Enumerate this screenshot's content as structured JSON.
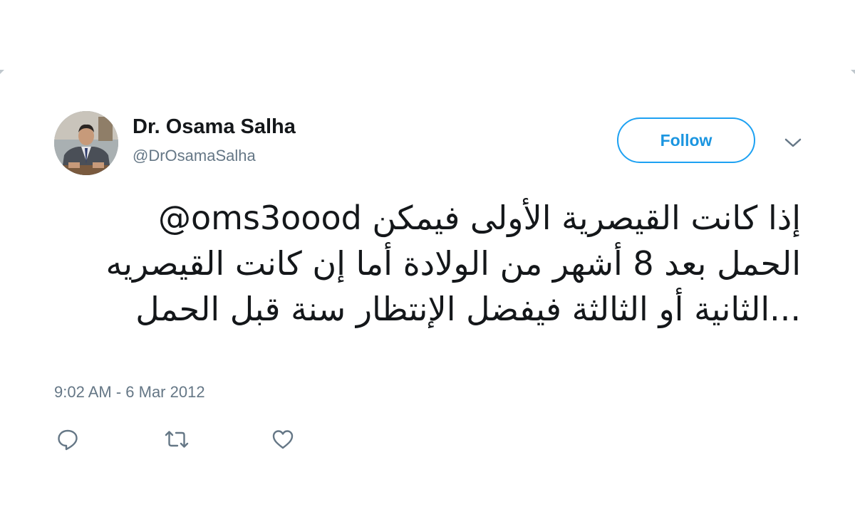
{
  "tweet": {
    "author": {
      "display_name": "Dr. Osama Salha",
      "handle": "@DrOsamaSalha"
    },
    "follow_label": "Follow",
    "text": "@oms3oood إذا كانت القيصرية الأولى فيمكن الحمل بعد 8 أشهر من الولادة أما إن كانت القيصريه الثانية أو الثالثة فيفضل الإنتظار سنة قبل الحمل...",
    "timestamp": "9:02 AM - 6 Mar 2012"
  },
  "actions": [
    {
      "icon": "reply-icon"
    },
    {
      "icon": "retweet-icon"
    },
    {
      "icon": "like-icon"
    }
  ],
  "colors": {
    "accent": "#1da1f2",
    "text": "#14171a",
    "secondary": "#657786"
  }
}
